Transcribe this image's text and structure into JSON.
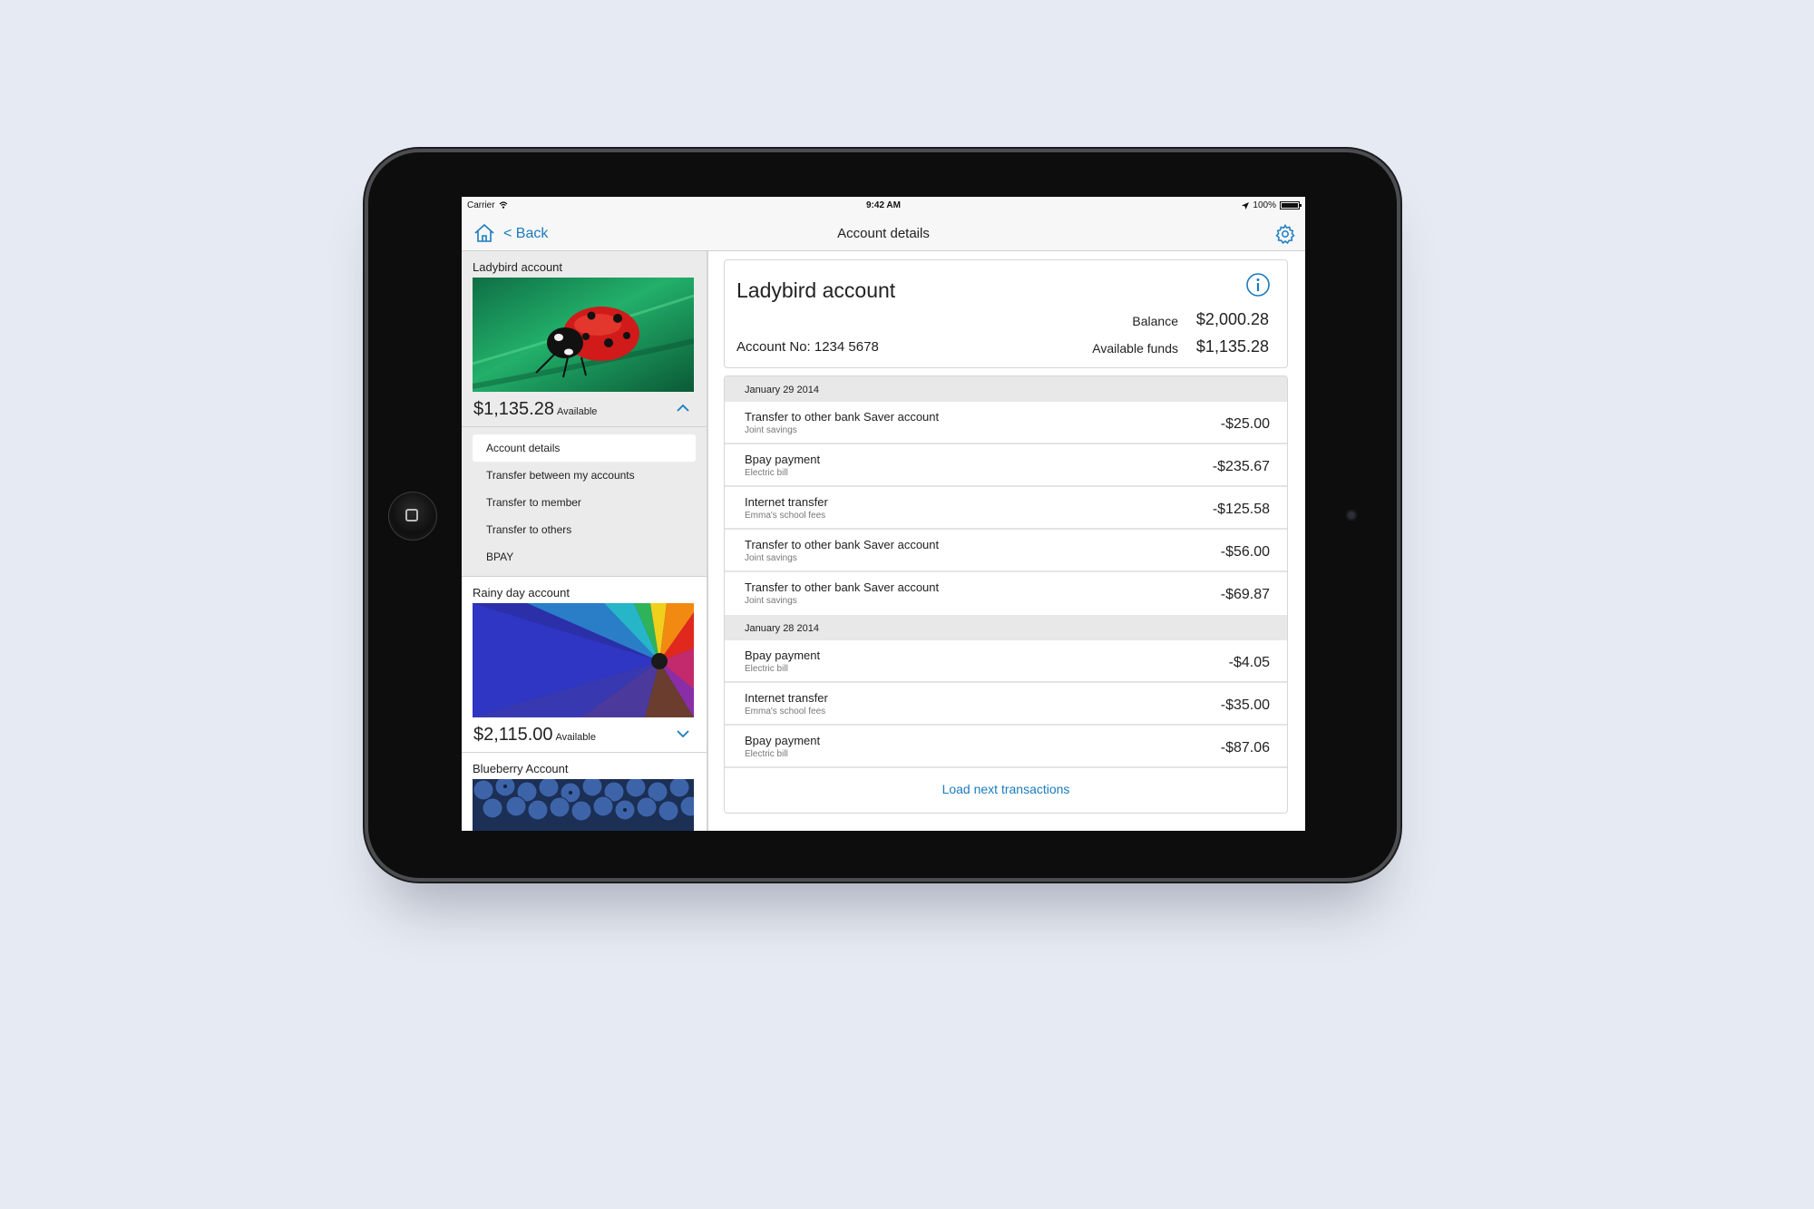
{
  "status_bar": {
    "carrier": "Carrier",
    "time": "9:42 AM",
    "battery": "100%"
  },
  "nav": {
    "back_label": "< Back",
    "title": "Account details"
  },
  "sidebar": {
    "accounts": [
      {
        "name": "Ladybird account",
        "amount": "$1,135.28",
        "available_label": "Available",
        "expanded": true
      },
      {
        "name": "Rainy day account",
        "amount": "$2,115.00",
        "available_label": "Available",
        "expanded": false
      },
      {
        "name": "Blueberry Account"
      }
    ],
    "menu": [
      {
        "label": "Account details",
        "active": true
      },
      {
        "label": "Transfer between my accounts"
      },
      {
        "label": "Transfer to member"
      },
      {
        "label": "Transfer to others"
      },
      {
        "label": "BPAY"
      }
    ]
  },
  "summary": {
    "title": "Ladybird account",
    "account_no": "Account No: 1234 5678",
    "balance_label": "Balance",
    "balance": "$2,000.28",
    "available_label": "Available funds",
    "available": "$1,135.28"
  },
  "transactions": {
    "groups": [
      {
        "date": "January 29 2014",
        "items": [
          {
            "title": "Transfer to other bank Saver account",
            "subtitle": "Joint savings",
            "amount": "-$25.00"
          },
          {
            "title": "Bpay payment",
            "subtitle": "Electric bill",
            "amount": "-$235.67"
          },
          {
            "title": "Internet transfer",
            "subtitle": "Emma's school fees",
            "amount": "-$125.58"
          },
          {
            "title": "Transfer to other bank Saver account",
            "subtitle": "Joint savings",
            "amount": "-$56.00"
          },
          {
            "title": "Transfer to other bank Saver account",
            "subtitle": "Joint savings",
            "amount": "-$69.87"
          }
        ]
      },
      {
        "date": "January 28 2014",
        "items": [
          {
            "title": "Bpay payment",
            "subtitle": "Electric bill",
            "amount": "-$4.05"
          },
          {
            "title": "Internet transfer",
            "subtitle": "Emma's school fees",
            "amount": "-$35.00"
          },
          {
            "title": "Bpay payment",
            "subtitle": "Electric bill",
            "amount": "-$87.06"
          }
        ]
      }
    ],
    "load_more_label": "Load next transactions"
  },
  "colors": {
    "accent": "#1a7bbf",
    "page_background": "#e6eaf2",
    "sidebar": "#ebebeb"
  }
}
